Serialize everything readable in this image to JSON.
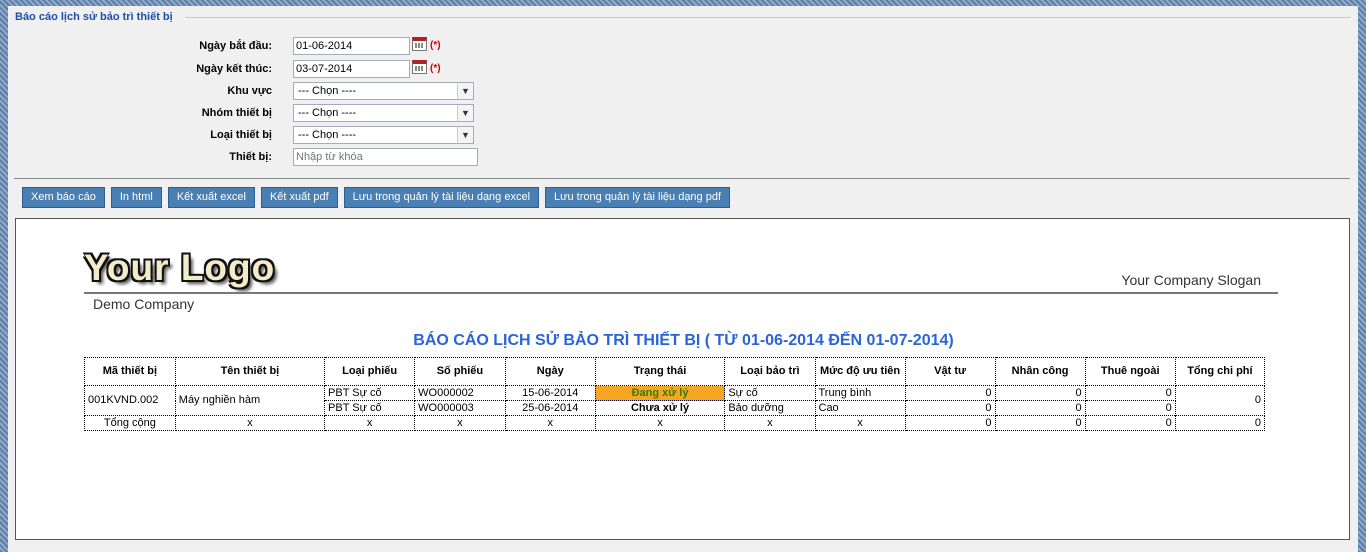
{
  "form": {
    "legend": "Báo cáo lịch sử bảo trì thiết bị",
    "start_date_label": "Ngày bắt đầu:",
    "start_date_value": "01-06-2014",
    "end_date_label": "Ngày kết thúc:",
    "end_date_value": "03-07-2014",
    "required_mark": "(*)",
    "area_label": "Khu vực",
    "area_value": "--- Chọn ----",
    "group_label": "Nhóm thiết bị",
    "group_value": "--- Chọn ----",
    "type_label": "Loại thiết bị",
    "type_value": "--- Chọn ----",
    "device_label": "Thiết bị:",
    "device_placeholder": "Nhập từ khóa"
  },
  "buttons": {
    "view": "Xem báo cáo",
    "print_html": "In html",
    "export_excel": "Kết xuất excel",
    "export_pdf": "Kết xuất pdf",
    "save_excel": "Lưu trong quản lý tài liệu dạng excel",
    "save_pdf": "Lưu trong quản lý tài liệu dạng pdf"
  },
  "report": {
    "logo_text": "Your Logo",
    "slogan": "Your Company Slogan",
    "company": "Demo Company",
    "title": "BÁO CÁO LỊCH SỬ BẢO TRÌ THIẾT BỊ ( TỪ 01-06-2014 ĐẾN 01-07-2014)",
    "columns": [
      "Mã thiết bị",
      "Tên thiết bị",
      "Loại phiếu",
      "Số phiếu",
      "Ngày",
      "Trạng thái",
      "Loại bảo trì",
      "Mức độ ưu tiên",
      "Vật tư",
      "Nhân công",
      "Thuê ngoài",
      "Tổng chi phí"
    ],
    "device_code": "001KVND.002",
    "device_name": "Máy nghiền hàm",
    "total_cost": "0",
    "rows": [
      {
        "ticket_type": "PBT Sự cố",
        "ticket_no": "WO000002",
        "date": "15-06-2014",
        "status": "Đang xử lý",
        "maint_type": "Sự cố",
        "priority": "Trung bình",
        "material": "0",
        "labor": "0",
        "outsource": "0"
      },
      {
        "ticket_type": "PBT Sự cố",
        "ticket_no": "WO000003",
        "date": "25-06-2014",
        "status": "Chưa xử lý",
        "maint_type": "Bảo dưỡng",
        "priority": "Cao",
        "material": "0",
        "labor": "0",
        "outsource": "0"
      }
    ],
    "total_row": {
      "label": "Tổng cộng",
      "x": "x",
      "material": "0",
      "labor": "0",
      "outsource": "0",
      "total": "0"
    }
  },
  "colors": {
    "button_bg": "#4a7fb4",
    "title_blue": "#2a64d8",
    "status_processing_bg": "#f5a623",
    "required_red": "#d00000"
  }
}
